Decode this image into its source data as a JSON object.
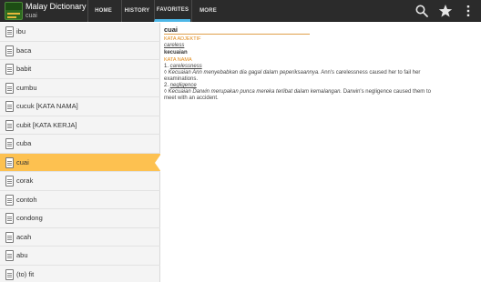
{
  "app": {
    "title": "Malay Dictionary",
    "subtitle": "cuai",
    "logo_text": "Collins"
  },
  "tabs": [
    {
      "label": "HOME"
    },
    {
      "label": "HISTORY"
    },
    {
      "label": "FAVORITES",
      "active": true
    },
    {
      "label": "MORE"
    }
  ],
  "actions": {
    "search_icon": "search-icon",
    "favorite_icon": "star-icon",
    "overflow_icon": "overflow-menu-icon"
  },
  "list": {
    "items": [
      {
        "label": "ibu"
      },
      {
        "label": "baca"
      },
      {
        "label": "babit"
      },
      {
        "label": "cumbu"
      },
      {
        "label": "cucuk [KATA NAMA]"
      },
      {
        "label": "cubit [KATA KERJA]"
      },
      {
        "label": "cuba"
      },
      {
        "label": "cuai",
        "selected": true
      },
      {
        "label": "corak"
      },
      {
        "label": "contoh"
      },
      {
        "label": "condong"
      },
      {
        "label": "acah"
      },
      {
        "label": "abu"
      },
      {
        "label": "(to) fit"
      }
    ]
  },
  "entry": {
    "headword": "cuai",
    "pos1": "KATA ADJEKTIF",
    "pos1_trans": "careless",
    "derived": "kecuaian",
    "pos2": "KATA NAMA",
    "sense1_num": "1. ",
    "sense1_trans": "carelessness",
    "sense1_example_ms": "Kecuaian Ann menyebabkan dia gagal dalam peperiksaannya.",
    "sense1_example_en_a": " Ann's carelessness caused her to fail her",
    "sense1_example_en_b": "examinations.",
    "sense2_num": "2. ",
    "sense2_trans": "negligence",
    "sense2_example_ms": "Kecuaian Darwin merupakan punca mereka terlibat dalam kemalangan.",
    "sense2_example_en_a": " Darwin's negligence caused them to",
    "sense2_example_en_b": "meet with an accident.",
    "bullet": "◊ "
  },
  "colors": {
    "actionbar": "#2b2b2b",
    "selected_row": "#fdc150",
    "pos_label": "#e08a1a",
    "tab_indicator": "#4db6e6"
  }
}
